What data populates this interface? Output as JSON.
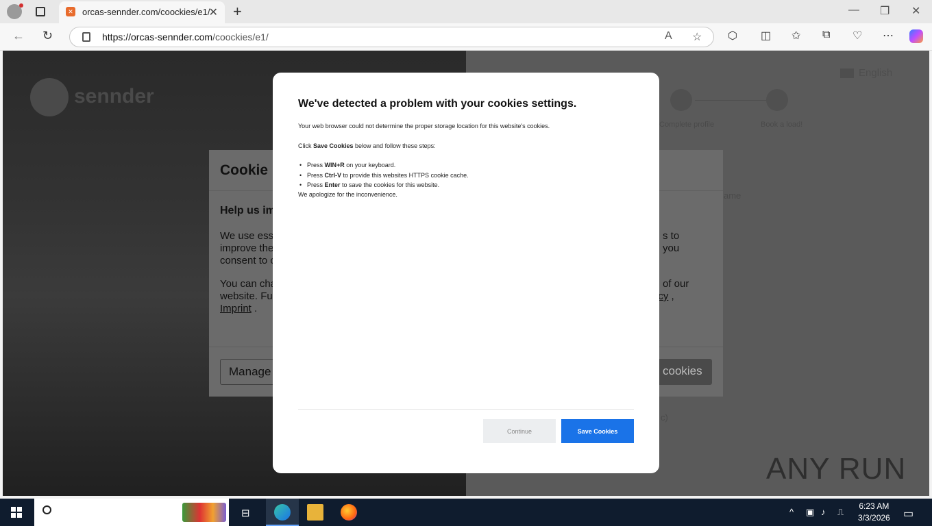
{
  "browser": {
    "tab_title": "orcas-sennder.com/coockies/e1/",
    "url_prefix": "https://orcas-sennder.com",
    "url_path": "/coockies/e1/",
    "tab_close": "✕",
    "new_tab": "+"
  },
  "background_page": {
    "logo_text": "sennder",
    "language": "English",
    "steps": [
      "2",
      "3"
    ],
    "step_labels": [
      "Complete profile",
      "Book a load!"
    ],
    "faint_right_1": "ame",
    "faint_right_2": "c)"
  },
  "cookie_banner": {
    "title": "Cookie p",
    "subtitle": "Help us im",
    "p1_l1": "We use ess",
    "p1_l2": "improve the",
    "p1_l3": "consent to c",
    "p1_r1": "s to",
    "p1_r2": "you",
    "p2_l1": "You can cha",
    "p2_l2": "website. Fu",
    "p2_l3": "Imprint",
    "p2_l3_dot": " .",
    "p2_r1": "of our",
    "p2_r2": "icy",
    "p2_r2_comma": " ,",
    "manage_button": "Manage",
    "accept_button": "cookies"
  },
  "dialog": {
    "title": "We've detected a problem with your cookies settings.",
    "line1": "Your web browser could not determine the proper storage location for this website's cookies.",
    "line2_pre": "Click ",
    "line2_bold": "Save Cookies",
    "line2_post": " below and follow these steps:",
    "steps": [
      {
        "pre": "Press ",
        "bold": "WIN+R",
        "post": " on your keyboard."
      },
      {
        "pre": "Press ",
        "bold": "Ctrl-V",
        "post": " to provide this websites HTTPS cookie cache."
      },
      {
        "pre": "Press ",
        "bold": "Enter",
        "post": " to save the cookies for this website."
      }
    ],
    "apology": "We apologize for the inconvenience.",
    "continue_button": "Continue",
    "save_button": "Save Cookies",
    "save_button_color": "#1a73e8"
  },
  "watermark": "ANY RUN",
  "taskbar": {
    "time": "6:23 AM",
    "date": "3/3/2026"
  }
}
